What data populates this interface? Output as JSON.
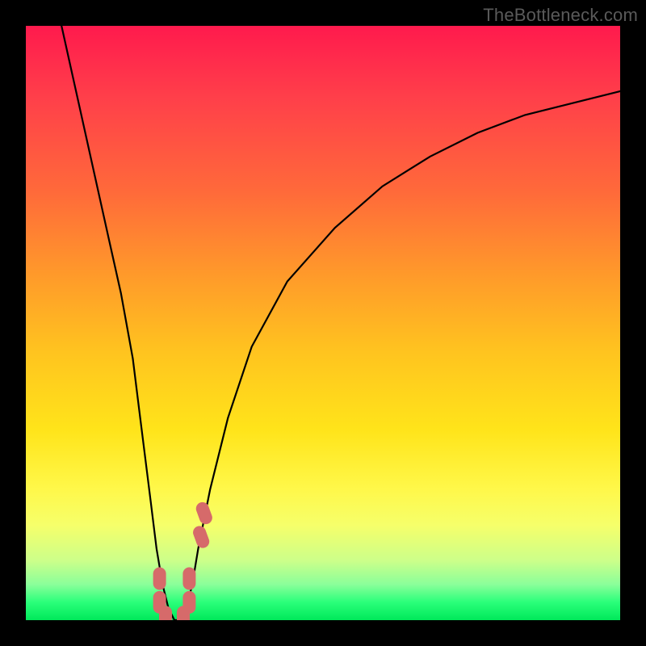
{
  "watermark": "TheBottleneck.com",
  "chart_data": {
    "type": "line",
    "title": "",
    "xlabel": "",
    "ylabel": "",
    "xlim": [
      0,
      100
    ],
    "ylim": [
      0,
      100
    ],
    "grid": false,
    "background_gradient_stops": [
      {
        "pos": 0.0,
        "color": "#ff1a4d"
      },
      {
        "pos": 0.55,
        "color": "#ffc41f"
      },
      {
        "pos": 0.8,
        "color": "#fff84a"
      },
      {
        "pos": 0.95,
        "color": "#4aff7a"
      },
      {
        "pos": 1.0,
        "color": "#00e85a"
      }
    ],
    "series": [
      {
        "name": "bottleneck-curve",
        "color": "#000000",
        "x": [
          6,
          8,
          10,
          12,
          14,
          16,
          18,
          19,
          20,
          21,
          22,
          23,
          24,
          25,
          26,
          27,
          28,
          29,
          31,
          34,
          38,
          44,
          52,
          60,
          68,
          76,
          84,
          92,
          100
        ],
        "y": [
          100,
          91,
          82,
          73,
          64,
          55,
          44,
          36,
          28,
          20,
          12,
          6,
          2,
          0,
          0,
          2,
          6,
          12,
          22,
          34,
          46,
          57,
          66,
          73,
          78,
          82,
          85,
          87,
          89
        ]
      }
    ],
    "annotations": [
      {
        "name": "marker-group-bottom",
        "color": "#d66a6a",
        "points": [
          {
            "x": 22.5,
            "y": 7
          },
          {
            "x": 22.5,
            "y": 3
          },
          {
            "x": 23.5,
            "y": 0.5
          },
          {
            "x": 26.5,
            "y": 0.5
          },
          {
            "x": 27.5,
            "y": 3
          },
          {
            "x": 27.5,
            "y": 7
          },
          {
            "x": 29.5,
            "y": 14
          },
          {
            "x": 30.0,
            "y": 18
          }
        ]
      }
    ]
  }
}
